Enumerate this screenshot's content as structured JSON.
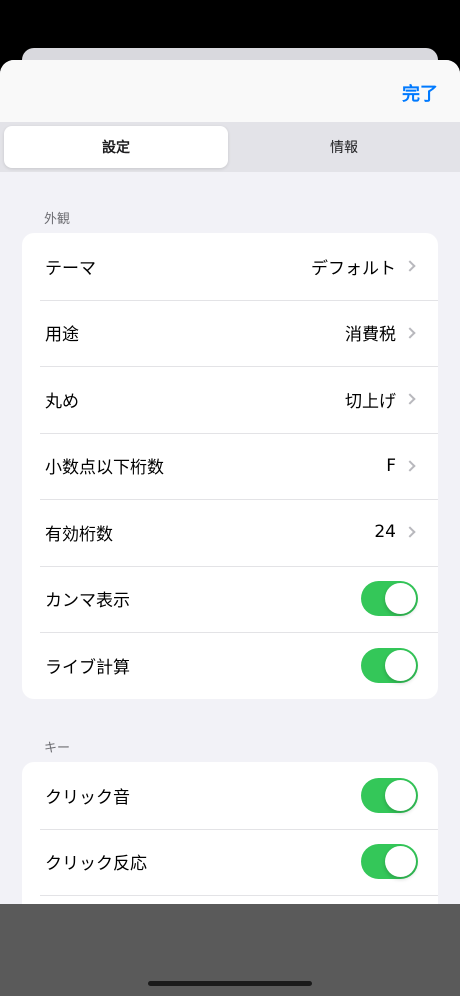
{
  "header": {
    "done_label": "完了"
  },
  "tabs": [
    {
      "label": "設定",
      "active": true
    },
    {
      "label": "情報",
      "active": false
    }
  ],
  "sections": {
    "appearance": {
      "title": "外観",
      "rows": [
        {
          "label": "テーマ",
          "value": "デフォルト"
        },
        {
          "label": "用途",
          "value": "消費税"
        },
        {
          "label": "丸め",
          "value": "切上げ"
        },
        {
          "label": "小数点以下桁数",
          "value": "F"
        },
        {
          "label": "有効桁数",
          "value": "24"
        },
        {
          "label": "カンマ表示",
          "toggle": true
        },
        {
          "label": "ライブ計算",
          "toggle": true
        }
      ]
    },
    "keys": {
      "title": "キー",
      "rows": [
        {
          "label": "クリック音",
          "toggle": true
        },
        {
          "label": "クリック反応",
          "toggle": true
        }
      ]
    }
  },
  "colors": {
    "accent": "#007aff",
    "toggle_on": "#34c759"
  }
}
